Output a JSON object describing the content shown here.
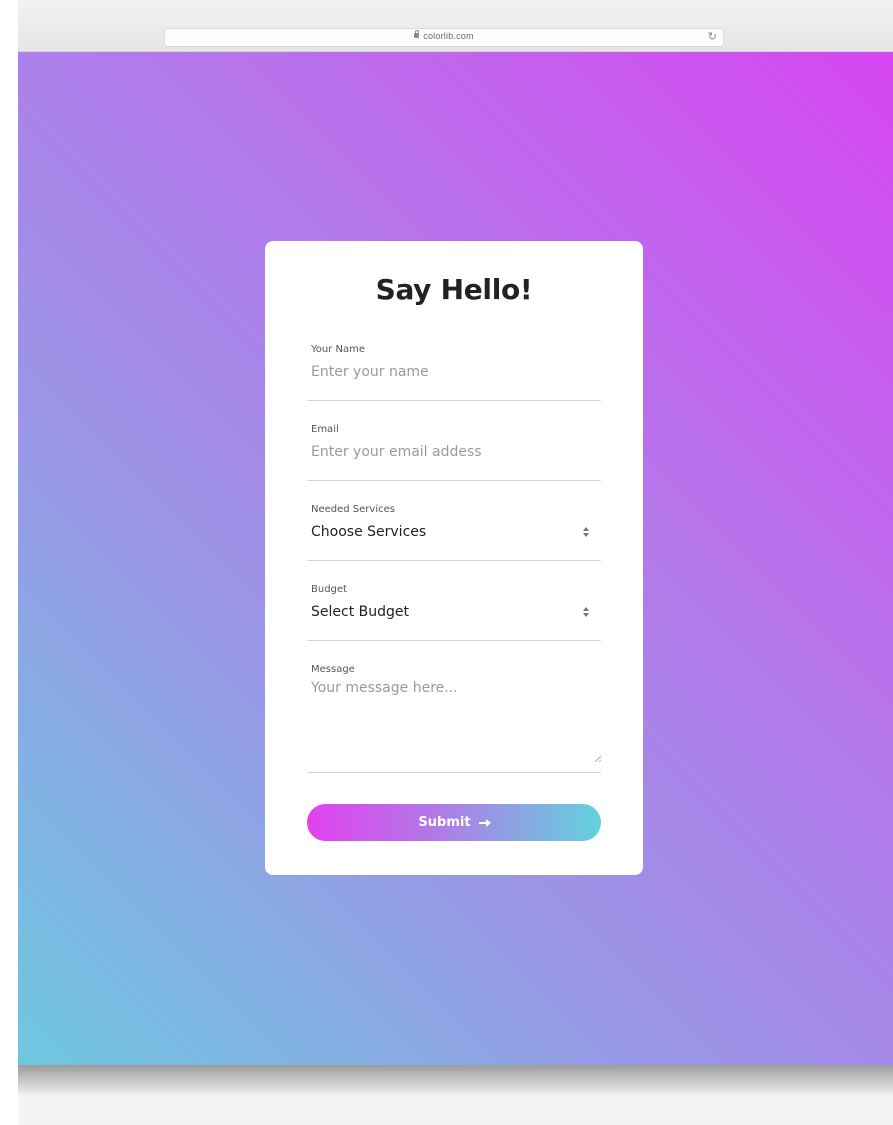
{
  "browser": {
    "url": "colorlib.com",
    "lock_icon": "lock-icon",
    "reload_icon": "reload-icon"
  },
  "colors": {
    "gradient_start": "#d646f2",
    "gradient_end": "#6ec8e0",
    "button_start": "#e141ef",
    "button_end": "#62d2de",
    "card_background": "#ffffff"
  },
  "form": {
    "title": "Say Hello!",
    "name": {
      "label": "Your Name",
      "placeholder": "Enter your name",
      "value": ""
    },
    "email": {
      "label": "Email",
      "placeholder": "Enter your email addess",
      "value": ""
    },
    "services": {
      "label": "Needed Services",
      "selected": "Choose Services",
      "icon": "sort-icon"
    },
    "budget": {
      "label": "Budget",
      "selected": "Select Budget",
      "icon": "sort-icon"
    },
    "message": {
      "label": "Message",
      "placeholder": "Your message here...",
      "value": ""
    },
    "submit": {
      "label": "Submit",
      "icon": "arrow-right-icon"
    }
  }
}
